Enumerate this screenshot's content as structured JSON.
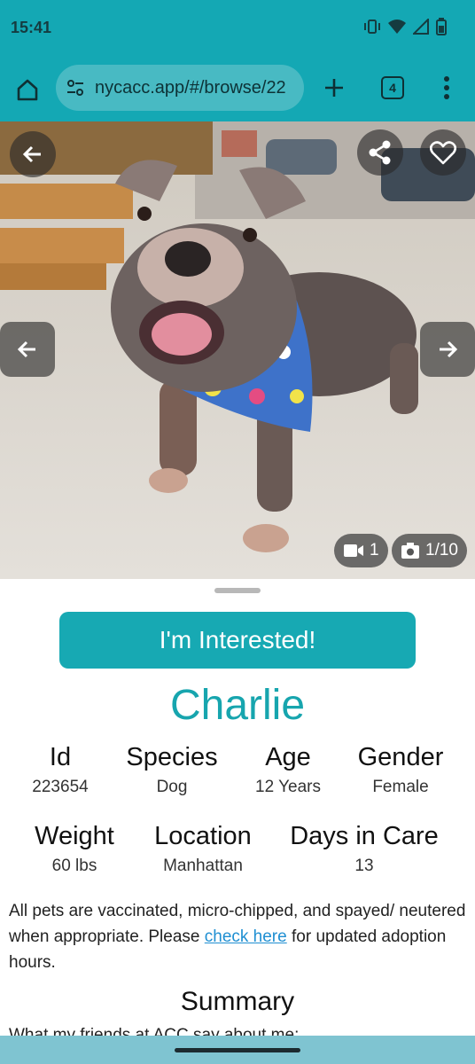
{
  "status_bar": {
    "time": "15:41",
    "icons": [
      "vibrate-icon",
      "wifi-icon",
      "signal-icon",
      "battery-icon"
    ]
  },
  "browser": {
    "url": "nycacc.app/#/browse/22",
    "tab_count": "4",
    "accent_color": "#14a8b4"
  },
  "photo": {
    "video_count": "1",
    "photo_counter": "1/10"
  },
  "interested_button": "I'm Interested!",
  "pet": {
    "name": "Charlie",
    "id_label": "Id",
    "id_value": "223654",
    "species_label": "Species",
    "species_value": "Dog",
    "age_label": "Age",
    "age_value": "12 Years",
    "gender_label": "Gender",
    "gender_value": "Female",
    "weight_label": "Weight",
    "weight_value": "60 lbs",
    "location_label": "Location",
    "location_value": "Manhattan",
    "days_label": "Days in Care",
    "days_value": "13"
  },
  "notice": {
    "before_link": "All pets are vaccinated, micro-chipped, and spayed/ neutered when appropriate. Please ",
    "link_text": "check here",
    "after_link": " for updated adoption hours."
  },
  "summary": {
    "title": "Summary",
    "subtitle": "What my friends at ACC say about me:"
  }
}
